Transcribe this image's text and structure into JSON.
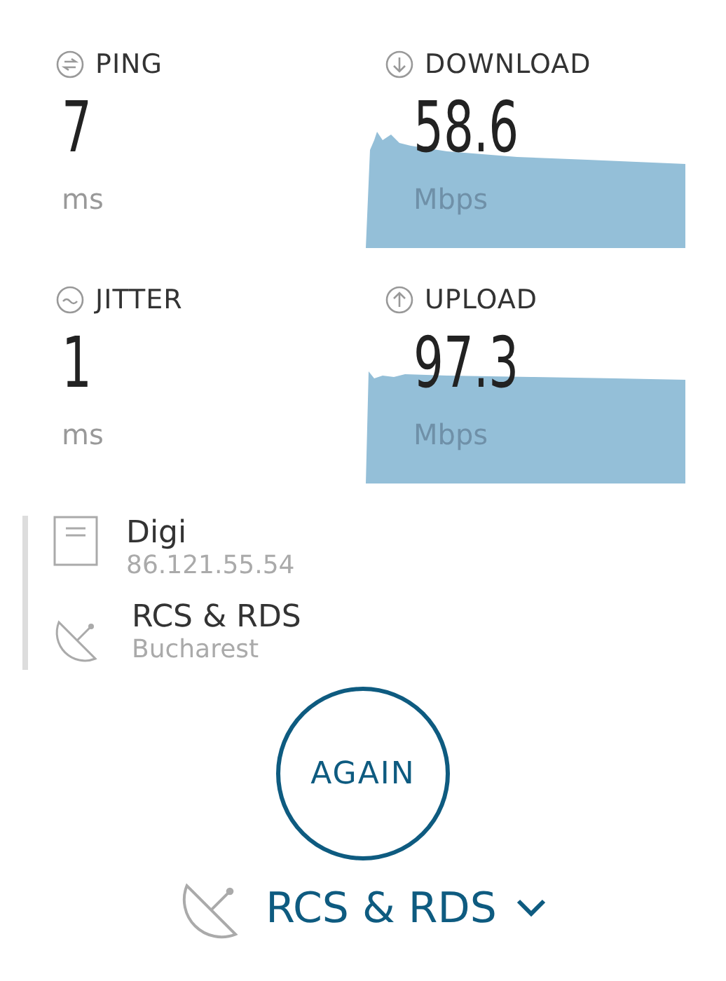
{
  "metrics": [
    {
      "kind": "ping",
      "label": "PING",
      "value": "7",
      "unit": "ms"
    },
    {
      "kind": "download",
      "label": "DOWNLOAD",
      "value": "58.6",
      "unit": "Mbps"
    },
    {
      "kind": "jitter",
      "label": "JITTER",
      "value": "1",
      "unit": "ms"
    },
    {
      "kind": "upload",
      "label": "UPLOAD",
      "value": "97.3",
      "unit": "Mbps"
    }
  ],
  "connections": [
    {
      "kind": "client",
      "name": "Digi",
      "detail": "86.121.55.54"
    },
    {
      "kind": "server",
      "name": "RCS & RDS",
      "detail": "Bucharest"
    }
  ],
  "again_button": "AGAIN",
  "server_selector": {
    "label": "RCS & RDS"
  }
}
